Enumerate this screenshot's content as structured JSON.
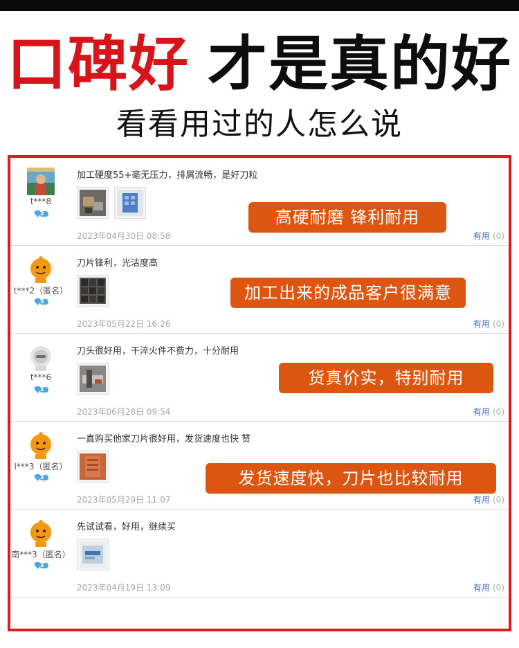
{
  "headline": {
    "red": "口碑好",
    "black": "才是真的好"
  },
  "subheadline": "看看用过的人怎么说",
  "useful_label": "有用",
  "reviews": [
    {
      "user": "t***8",
      "vip_level": "2",
      "comment": "加工硬度55+毫无压力，排屑流畅，是好刀粒",
      "date": "2023年04月30日 08:58",
      "useful_count": "(0)",
      "badge": "高硬耐磨 锋利耐用"
    },
    {
      "user": "t***2（匿名）",
      "vip_level": "5",
      "comment": "刀片锋利，光洁度高",
      "date": "2023年05月22日 16:26",
      "useful_count": "(0)",
      "badge": "加工出来的成品客户很满意"
    },
    {
      "user": "t***6",
      "vip_level": "2",
      "comment": "刀头很好用，干淬火件不费力，十分耐用",
      "date": "2023年06月28日 09:54",
      "useful_count": "(0)",
      "badge": "货真价实，特别耐用"
    },
    {
      "user": "l***3（匿名）",
      "vip_level": "3",
      "comment": "一直购买他家刀片很好用，发货速度也快 赞",
      "date": "2023年05月29日 11:07",
      "useful_count": "(0)",
      "badge": "发货速度快，刀片也比较耐用"
    },
    {
      "user": "南***3（匿名）",
      "vip_level": "3",
      "comment": "先试试看，好用，继续买",
      "date": "2023年04月19日 13:09",
      "useful_count": "(0)"
    }
  ],
  "colors": {
    "headline_red": "#d8141b",
    "frame_red": "#e01a1a",
    "badge_orange": "#dd5611",
    "link_blue": "#3c6fb8"
  }
}
